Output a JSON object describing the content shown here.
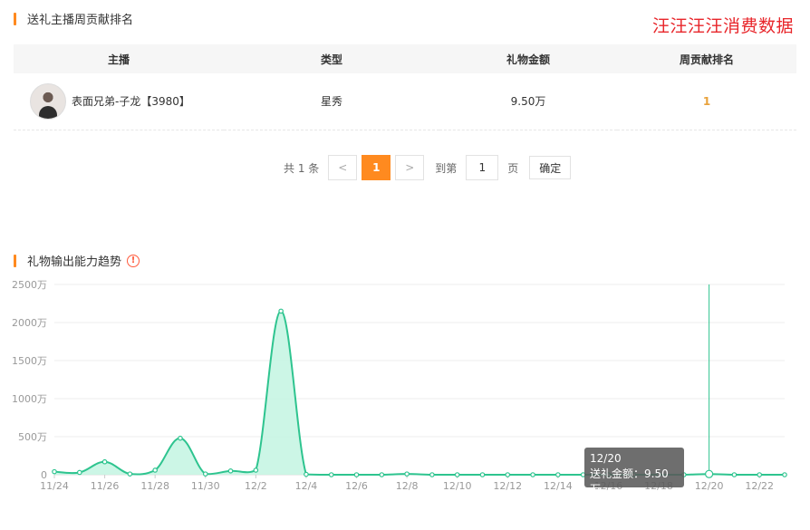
{
  "section1": {
    "title": "送礼主播周贡献排名"
  },
  "watermark": "汪汪汪汪消费数据",
  "table": {
    "headers": [
      "主播",
      "类型",
      "礼物金额",
      "周贡献排名"
    ],
    "rows": [
      {
        "anchor": "表面兄弟-子龙【3980】",
        "type": "星秀",
        "amount": "9.50万",
        "rank": "1"
      }
    ]
  },
  "pagination": {
    "total": "共 1 条",
    "prev": "<",
    "current": "1",
    "next": ">",
    "goto_label": "到第",
    "goto_value": "1",
    "page_suffix": "页",
    "confirm": "确定"
  },
  "section2": {
    "title": "礼物输出能力趋势",
    "info_icon": "!"
  },
  "colors": {
    "accent": "#ff8a1f",
    "line": "#2ec48f",
    "fill": "#c3f5e2"
  },
  "chart_data": {
    "type": "area",
    "x": [
      "11/24",
      "11/25",
      "11/26",
      "11/27",
      "11/28",
      "11/29",
      "11/30",
      "12/1",
      "12/2",
      "12/3",
      "12/4",
      "12/5",
      "12/6",
      "12/7",
      "12/8",
      "12/9",
      "12/10",
      "12/11",
      "12/12",
      "12/13",
      "12/14",
      "12/15",
      "12/16",
      "12/17",
      "12/18",
      "12/19",
      "12/20",
      "12/21",
      "12/22",
      "12/23"
    ],
    "x_tick_labels": [
      "11/24",
      "11/26",
      "11/28",
      "11/30",
      "12/2",
      "12/4",
      "12/6",
      "12/8",
      "12/10",
      "12/12",
      "12/14",
      "12/16",
      "12/18",
      "12/20",
      "12/22"
    ],
    "series": [
      {
        "values": [
          40,
          30,
          170,
          10,
          60,
          480,
          10,
          50,
          60,
          2150,
          5,
          0,
          0,
          0,
          10,
          0,
          0,
          0,
          0,
          0,
          0,
          0,
          0,
          0,
          0,
          0,
          9.5,
          0,
          0,
          0
        ]
      }
    ],
    "ylim": [
      0,
      2500
    ],
    "y_ticks": [
      0,
      500,
      1000,
      1500,
      2000,
      2500
    ],
    "y_tick_labels": [
      "0",
      "500万",
      "1000万",
      "1500万",
      "2000万",
      "2500万"
    ],
    "grid": true,
    "tooltip": {
      "date": "12/20",
      "label": "送礼金额：9.50万"
    }
  }
}
